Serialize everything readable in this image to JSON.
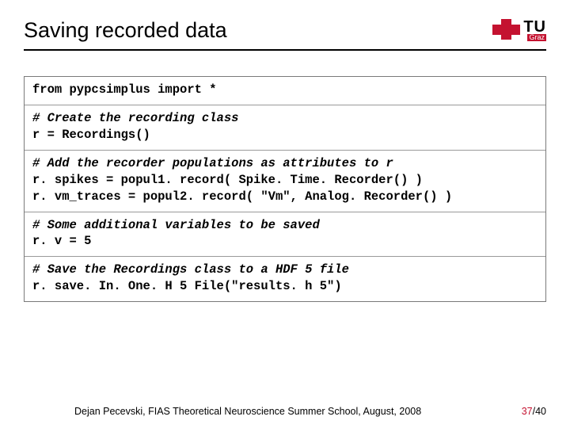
{
  "header": {
    "title": "Saving recorded data",
    "logo_tu": "TU",
    "logo_graz": "Graz"
  },
  "code": {
    "r1_l1": "from pypcsimplus import *",
    "r2_c1": "# Create the recording class",
    "r2_l1": "r = Recordings()",
    "r3_c1": "# Add the recorder populations as attributes to r",
    "r3_l1": "r. spikes = popul1. record( Spike. Time. Recorder() )",
    "r3_l2": "r. vm_traces = popul2. record( \"Vm\", Analog. Recorder() )",
    "r4_c1": "# Some additional variables to be saved",
    "r4_l1": "r. v = 5",
    "r5_c1": "# Save the Recordings class to a HDF 5 file",
    "r5_l1": "r. save. In. One. H 5 File(\"results. h 5\")"
  },
  "footer": {
    "text": "Dejan Pecevski, FIAS Theoretical Neuroscience Summer School, August, 2008",
    "page_current": "37",
    "page_sep": "/",
    "page_total": "40"
  }
}
